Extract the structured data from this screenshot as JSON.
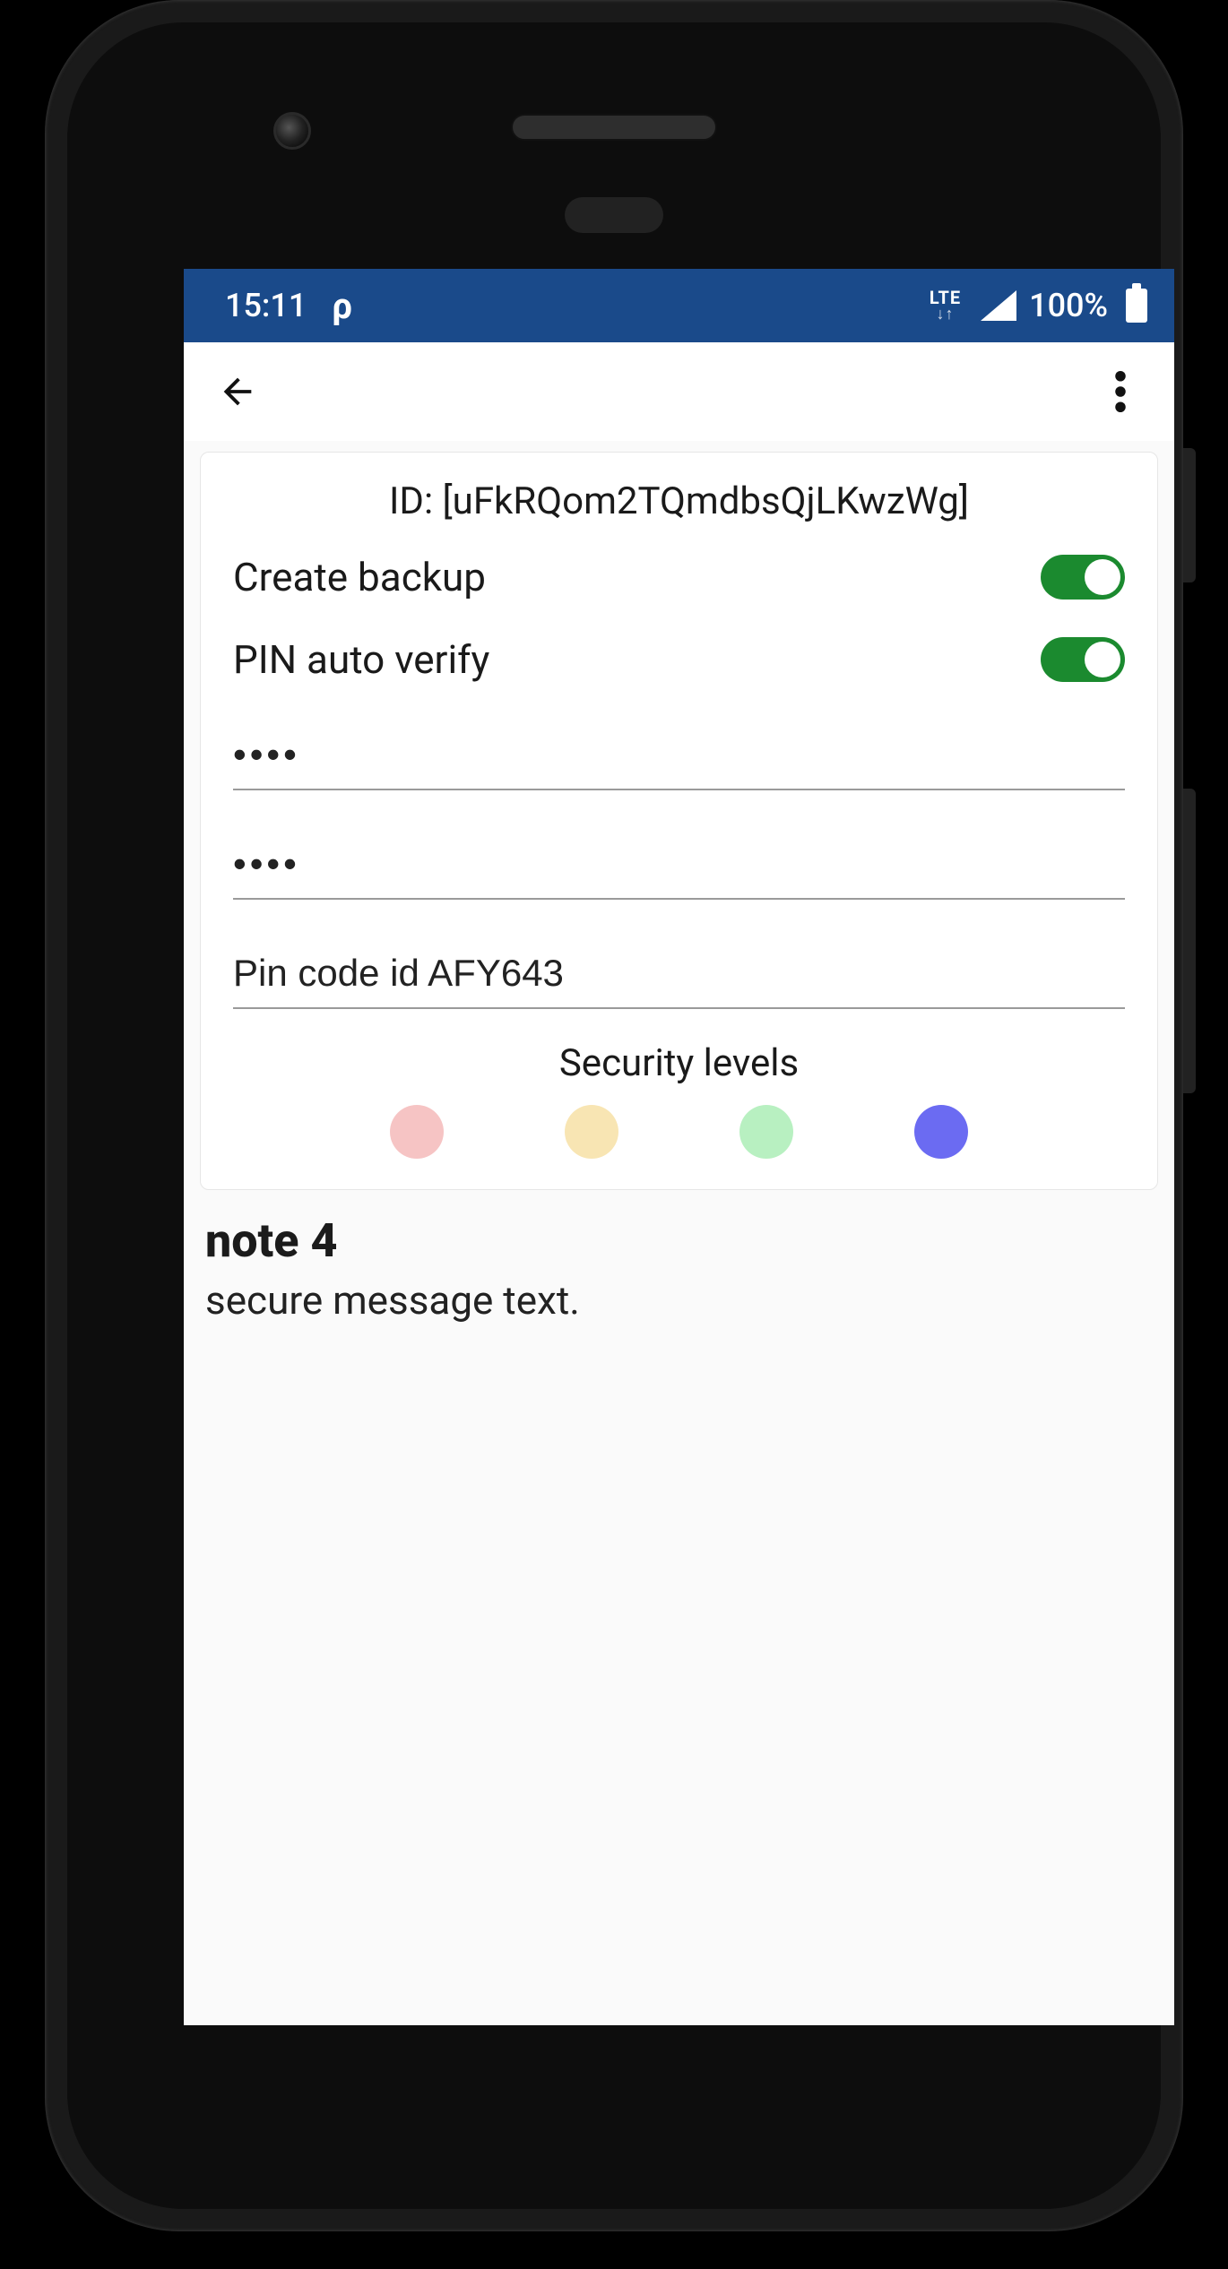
{
  "statusbar": {
    "time": "15:11",
    "network_label": "LTE",
    "battery_text": "100%"
  },
  "card": {
    "id_text": "ID: [uFkRQom2TQmdbsQjLKwzWg]",
    "create_backup_label": "Create backup",
    "create_backup_on": true,
    "pin_auto_verify_label": "PIN auto verify",
    "pin_auto_verify_on": true,
    "pin1_value": "••••",
    "pin2_value": "••••",
    "pin_code_id_value": "Pin code id AFY643",
    "security_levels_label": "Security levels",
    "level_colors": [
      "#f6c4c4",
      "#f8e5b3",
      "#b8f0c1",
      "#6b6bf2"
    ]
  },
  "note": {
    "title": "note 4",
    "body": "secure message text."
  }
}
